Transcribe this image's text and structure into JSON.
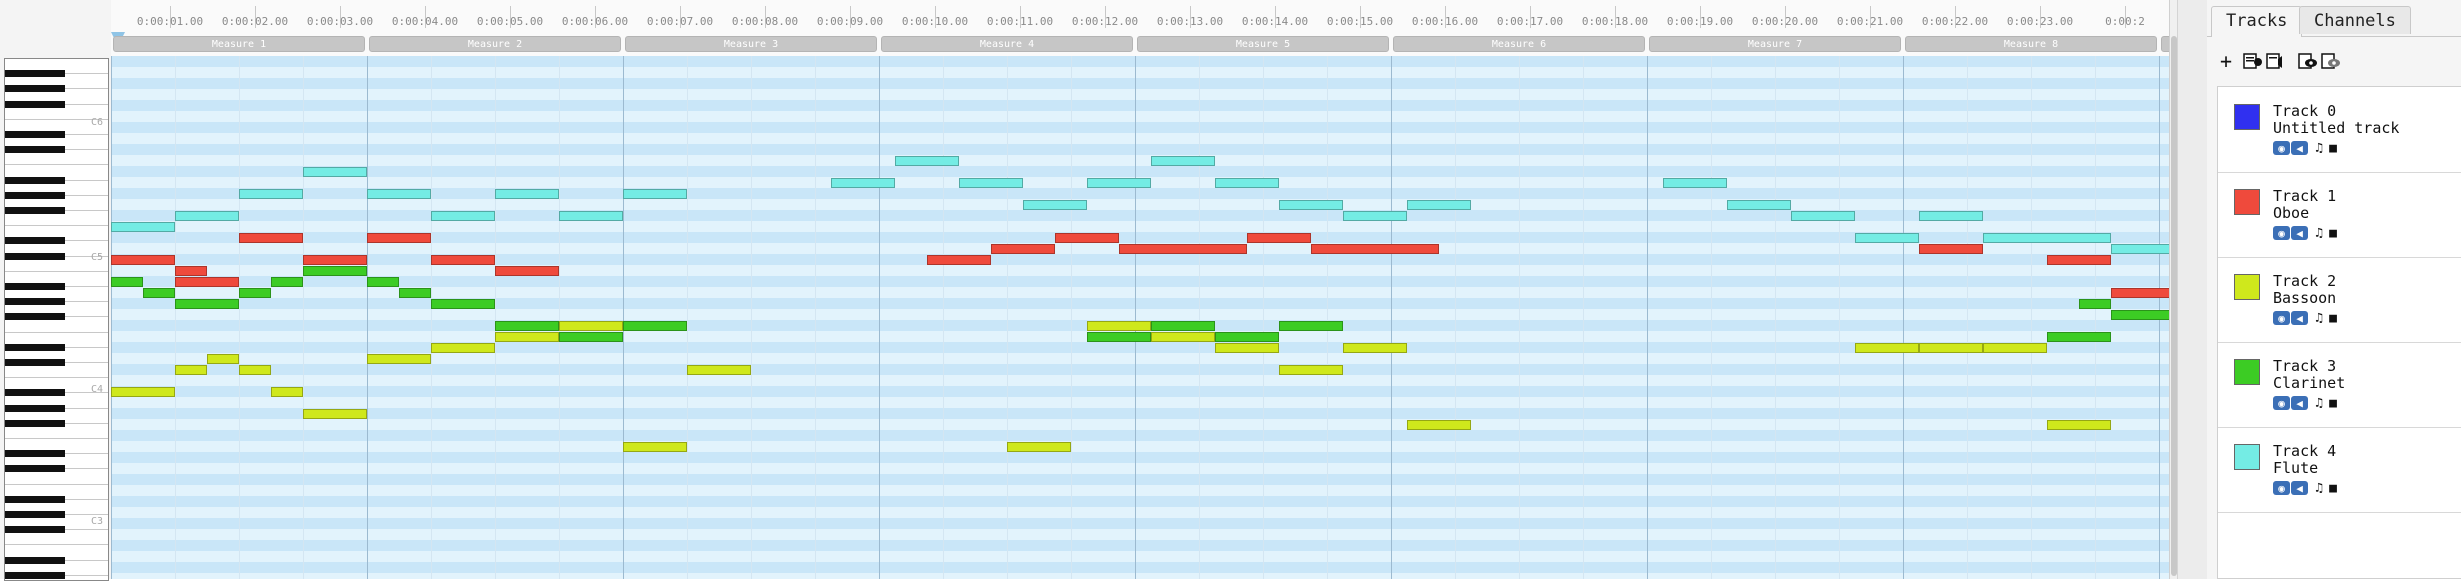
{
  "colors": {
    "track0": "#3030f0",
    "track1": "#ef4a3c",
    "track2": "#cfe81c",
    "track3": "#3ccc24",
    "track4": "#74ece4"
  },
  "piano": {
    "octave_labels": [
      "C6",
      "C5",
      "C4",
      "C3"
    ]
  },
  "timeline": {
    "time_labels": [
      "0:00:01.00",
      "0:00:02.00",
      "0:00:03.00",
      "0:00:04.00",
      "0:00:05.00",
      "0:00:06.00",
      "0:00:07.00",
      "0:00:08.00",
      "0:00:09.00",
      "0:00:10.00",
      "0:00:11.00",
      "0:00:12.00",
      "0:00:13.00",
      "0:00:14.00",
      "0:00:15.00",
      "0:00:16.00",
      "0:00:17.00",
      "0:00:18.00",
      "0:00:19.00",
      "0:00:20.00",
      "0:00:21.00",
      "0:00:22.00",
      "0:00:23.00",
      "0:00:2"
    ],
    "measures": [
      "Measure 1",
      "Measure 2",
      "Measure 3",
      "Measure 4",
      "Measure 5",
      "Measure 6",
      "Measure 7",
      "Measure 8"
    ]
  },
  "notes": [
    {
      "track": 4,
      "start": 0,
      "dur": 1,
      "row": 15
    },
    {
      "track": 4,
      "start": 1,
      "dur": 1,
      "row": 14
    },
    {
      "track": 4,
      "start": 2,
      "dur": 1,
      "row": 12
    },
    {
      "track": 4,
      "start": 3,
      "dur": 1,
      "row": 10
    },
    {
      "track": 4,
      "start": 4,
      "dur": 1,
      "row": 12
    },
    {
      "track": 4,
      "start": 5,
      "dur": 1,
      "row": 14
    },
    {
      "track": 4,
      "start": 6,
      "dur": 1,
      "row": 12
    },
    {
      "track": 4,
      "start": 7,
      "dur": 1,
      "row": 14
    },
    {
      "track": 4,
      "start": 8,
      "dur": 1,
      "row": 12
    },
    {
      "track": 4,
      "start": 11.25,
      "dur": 1,
      "row": 11
    },
    {
      "track": 4,
      "start": 12.25,
      "dur": 1,
      "row": 9
    },
    {
      "track": 4,
      "start": 13.25,
      "dur": 1,
      "row": 11
    },
    {
      "track": 4,
      "start": 14.25,
      "dur": 1,
      "row": 13
    },
    {
      "track": 4,
      "start": 15.25,
      "dur": 1,
      "row": 11
    },
    {
      "track": 4,
      "start": 16.25,
      "dur": 1,
      "row": 9
    },
    {
      "track": 4,
      "start": 17.25,
      "dur": 1,
      "row": 11
    },
    {
      "track": 4,
      "start": 18.25,
      "dur": 1,
      "row": 13
    },
    {
      "track": 4,
      "start": 19.25,
      "dur": 1,
      "row": 14
    },
    {
      "track": 4,
      "start": 20.25,
      "dur": 1,
      "row": 13
    },
    {
      "track": 4,
      "start": 24.25,
      "dur": 1,
      "row": 11
    },
    {
      "track": 4,
      "start": 25.25,
      "dur": 1,
      "row": 13
    },
    {
      "track": 4,
      "start": 26.25,
      "dur": 1,
      "row": 14
    },
    {
      "track": 4,
      "start": 27.25,
      "dur": 1,
      "row": 16
    },
    {
      "track": 4,
      "start": 28.25,
      "dur": 1,
      "row": 14
    },
    {
      "track": 4,
      "start": 29.25,
      "dur": 2,
      "row": 16
    },
    {
      "track": 4,
      "start": 31.25,
      "dur": 1,
      "row": 17
    },
    {
      "track": 1,
      "start": 0,
      "dur": 1,
      "row": 18
    },
    {
      "track": 1,
      "start": 1,
      "dur": 0.5,
      "row": 19
    },
    {
      "track": 1,
      "start": 1,
      "dur": 1,
      "row": 20
    },
    {
      "track": 1,
      "start": 2,
      "dur": 1,
      "row": 16
    },
    {
      "track": 1,
      "start": 3,
      "dur": 1,
      "row": 18
    },
    {
      "track": 1,
      "start": 4,
      "dur": 1,
      "row": 16
    },
    {
      "track": 1,
      "start": 5,
      "dur": 1,
      "row": 18
    },
    {
      "track": 1,
      "start": 6,
      "dur": 1,
      "row": 19
    },
    {
      "track": 1,
      "start": 12.75,
      "dur": 1,
      "row": 18
    },
    {
      "track": 1,
      "start": 13.75,
      "dur": 1,
      "row": 17
    },
    {
      "track": 1,
      "start": 14.75,
      "dur": 1,
      "row": 16
    },
    {
      "track": 1,
      "start": 15.75,
      "dur": 2,
      "row": 17
    },
    {
      "track": 1,
      "start": 17.75,
      "dur": 1,
      "row": 16
    },
    {
      "track": 1,
      "start": 18.75,
      "dur": 2,
      "row": 17
    },
    {
      "track": 1,
      "start": 28.25,
      "dur": 1,
      "row": 17
    },
    {
      "track": 1,
      "start": 30.25,
      "dur": 1,
      "row": 18
    },
    {
      "track": 1,
      "start": 31.25,
      "dur": 1,
      "row": 21
    },
    {
      "track": 3,
      "start": 0,
      "dur": 0.5,
      "row": 20
    },
    {
      "track": 3,
      "start": 0.5,
      "dur": 0.5,
      "row": 21
    },
    {
      "track": 3,
      "start": 1,
      "dur": 1,
      "row": 22
    },
    {
      "track": 3,
      "start": 2,
      "dur": 0.5,
      "row": 21
    },
    {
      "track": 3,
      "start": 2.5,
      "dur": 0.5,
      "row": 20
    },
    {
      "track": 3,
      "start": 3,
      "dur": 1,
      "row": 19
    },
    {
      "track": 3,
      "start": 4,
      "dur": 0.5,
      "row": 20
    },
    {
      "track": 3,
      "start": 4.5,
      "dur": 0.5,
      "row": 21
    },
    {
      "track": 3,
      "start": 5,
      "dur": 1,
      "row": 22
    },
    {
      "track": 3,
      "start": 6,
      "dur": 1,
      "row": 24
    },
    {
      "track": 3,
      "start": 7,
      "dur": 1,
      "row": 25
    },
    {
      "track": 3,
      "start": 8,
      "dur": 1,
      "row": 24
    },
    {
      "track": 3,
      "start": 15.25,
      "dur": 1,
      "row": 25
    },
    {
      "track": 3,
      "start": 16.25,
      "dur": 1,
      "row": 24
    },
    {
      "track": 3,
      "start": 17.25,
      "dur": 1,
      "row": 25
    },
    {
      "track": 3,
      "start": 18.25,
      "dur": 1,
      "row": 24
    },
    {
      "track": 3,
      "start": 30.25,
      "dur": 1,
      "row": 25
    },
    {
      "track": 3,
      "start": 30.75,
      "dur": 0.5,
      "row": 22
    },
    {
      "track": 3,
      "start": 31.25,
      "dur": 1,
      "row": 23
    },
    {
      "track": 2,
      "start": 0,
      "dur": 1,
      "row": 30
    },
    {
      "track": 2,
      "start": 1,
      "dur": 0.5,
      "row": 28
    },
    {
      "track": 2,
      "start": 1.5,
      "dur": 0.5,
      "row": 27
    },
    {
      "track": 2,
      "start": 2,
      "dur": 0.5,
      "row": 28
    },
    {
      "track": 2,
      "start": 2.5,
      "dur": 0.5,
      "row": 30
    },
    {
      "track": 2,
      "start": 3,
      "dur": 1,
      "row": 32
    },
    {
      "track": 2,
      "start": 4,
      "dur": 1,
      "row": 27
    },
    {
      "track": 2,
      "start": 5,
      "dur": 1,
      "row": 26
    },
    {
      "track": 2,
      "start": 6,
      "dur": 1,
      "row": 25
    },
    {
      "track": 2,
      "start": 7,
      "dur": 1,
      "row": 24
    },
    {
      "track": 2,
      "start": 8,
      "dur": 1,
      "row": 35
    },
    {
      "track": 2,
      "start": 9,
      "dur": 1,
      "row": 28
    },
    {
      "track": 2,
      "start": 14,
      "dur": 1,
      "row": 35
    },
    {
      "track": 2,
      "start": 15.25,
      "dur": 1,
      "row": 24
    },
    {
      "track": 2,
      "start": 16.25,
      "dur": 1,
      "row": 25
    },
    {
      "track": 2,
      "start": 17.25,
      "dur": 1,
      "row": 26
    },
    {
      "track": 2,
      "start": 18.25,
      "dur": 1,
      "row": 28
    },
    {
      "track": 2,
      "start": 19.25,
      "dur": 1,
      "row": 26
    },
    {
      "track": 2,
      "start": 20.25,
      "dur": 1,
      "row": 33
    },
    {
      "track": 2,
      "start": 27.25,
      "dur": 1,
      "row": 26
    },
    {
      "track": 2,
      "start": 28.25,
      "dur": 1,
      "row": 26
    },
    {
      "track": 2,
      "start": 29.25,
      "dur": 1,
      "row": 26
    },
    {
      "track": 2,
      "start": 30.25,
      "dur": 1,
      "row": 33
    }
  ],
  "panel": {
    "tabs": [
      "Tracks",
      "Channels"
    ],
    "tracks": [
      {
        "name": "Track 0",
        "instrument": "Untitled track"
      },
      {
        "name": "Track 1",
        "instrument": "Oboe"
      },
      {
        "name": "Track 2",
        "instrument": "Bassoon"
      },
      {
        "name": "Track 3",
        "instrument": "Clarinet"
      },
      {
        "name": "Track 4",
        "instrument": "Flute"
      }
    ]
  }
}
